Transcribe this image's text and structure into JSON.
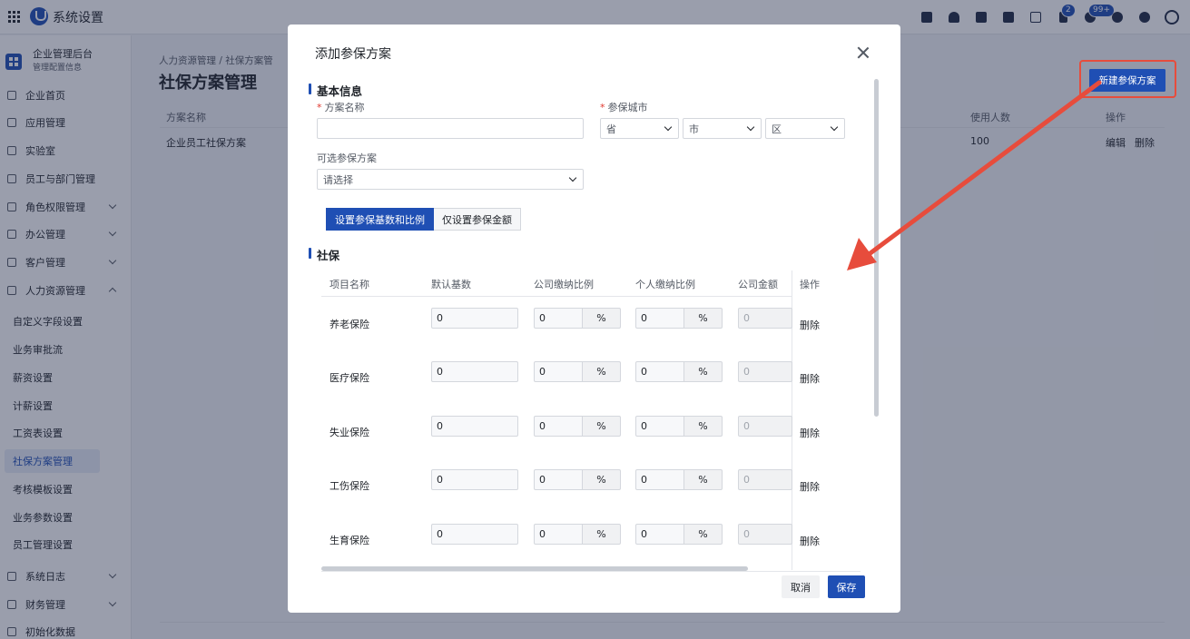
{
  "app": {
    "title": "系统设置"
  },
  "topbar": {
    "badge_flag": "2",
    "badge_bell": "99+"
  },
  "sidebar": {
    "org_name": "企业管理后台",
    "org_sub": "管理配置信息",
    "items": [
      "企业首页",
      "应用管理",
      "实验室",
      "员工与部门管理",
      "角色权限管理",
      "办公管理",
      "客户管理",
      "人力资源管理"
    ],
    "sub_items": [
      "自定义字段设置",
      "业务审批流",
      "薪资设置",
      "计薪设置",
      "工资表设置",
      "社保方案管理",
      "考核模板设置",
      "业务参数设置",
      "员工管理设置"
    ],
    "bottom_items": [
      "系统日志",
      "财务管理",
      "初始化数据"
    ]
  },
  "page": {
    "breadcrumb": "人力资源管理 / 社保方案管",
    "title": "社保方案管理",
    "new_button": "新建参保方案",
    "columns": {
      "name": "方案名称",
      "count": "使用人数",
      "ops": "操作"
    },
    "row": {
      "name": "企业员工社保方案",
      "count": "100",
      "edit": "编辑",
      "delete": "删除"
    }
  },
  "modal": {
    "title": "添加参保方案",
    "section_basic": "基本信息",
    "scheme_name_label": "方案名称",
    "scheme_name_value": "",
    "city_label": "参保城市",
    "province_placeholder": "省",
    "city_placeholder": "市",
    "district_placeholder": "区",
    "optional_label": "可选参保方案",
    "optional_placeholder": "请选择",
    "mode_on": "设置参保基数和比例",
    "mode_off": "仅设置参保金额",
    "section_social": "社保",
    "table_headers": {
      "item": "项目名称",
      "base": "默认基数",
      "company_ratio": "公司缴纳比例",
      "personal_ratio": "个人缴纳比例",
      "company_amount": "公司金额",
      "ops": "操作"
    },
    "rows": [
      {
        "name": "养老保险",
        "base": "0",
        "company": "0",
        "personal": "0",
        "amount": "0",
        "pct": "%",
        "op": "删除"
      },
      {
        "name": "医疗保险",
        "base": "0",
        "company": "0",
        "personal": "0",
        "amount": "0",
        "pct": "%",
        "op": "删除"
      },
      {
        "name": "失业保险",
        "base": "0",
        "company": "0",
        "personal": "0",
        "amount": "0",
        "pct": "%",
        "op": "删除"
      },
      {
        "name": "工伤保险",
        "base": "0",
        "company": "0",
        "personal": "0",
        "amount": "0",
        "pct": "%",
        "op": "删除"
      },
      {
        "name": "生育保险",
        "base": "0",
        "company": "0",
        "personal": "0",
        "amount": "0",
        "pct": "%",
        "op": "删除"
      }
    ],
    "cancel": "取消",
    "save": "保存"
  },
  "colors": {
    "accent": "#1f4fb4",
    "annotation": "#e74c3c"
  }
}
